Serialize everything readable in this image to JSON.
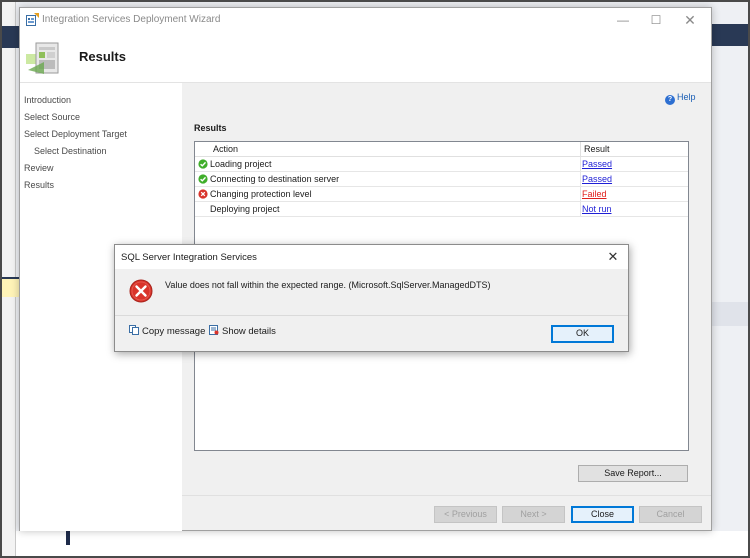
{
  "wizard": {
    "title": "Integration Services Deployment Wizard",
    "page_title": "Results",
    "window_controls": {
      "minimize": "—",
      "maximize": "☐",
      "close": "✕"
    },
    "nav_items": [
      {
        "label": "Introduction"
      },
      {
        "label": "Select Source"
      },
      {
        "label": "Select Deployment Target"
      },
      {
        "label": "Select Destination"
      },
      {
        "label": "Review"
      },
      {
        "label": "Results"
      }
    ],
    "help_label": "Help",
    "results_label": "Results",
    "table": {
      "headers": {
        "action": "Action",
        "result": "Result"
      },
      "rows": [
        {
          "action": "Loading project",
          "result": "Passed",
          "status": "pass"
        },
        {
          "action": "Connecting to destination server",
          "result": "Passed",
          "status": "pass"
        },
        {
          "action": "Changing protection level",
          "result": "Failed",
          "status": "fail"
        },
        {
          "action": "Deploying project",
          "result": "Not run",
          "status": "none"
        }
      ]
    },
    "buttons": {
      "save_report": "Save Report...",
      "previous": "< Previous",
      "next": "Next >",
      "close": "Close",
      "cancel": "Cancel"
    }
  },
  "dialog": {
    "title": "SQL Server Integration Services",
    "close": "✕",
    "message": "Value does not fall within the expected range. (Microsoft.SqlServer.ManagedDTS)",
    "copy_message": "Copy message",
    "show_details": "Show details",
    "ok": "OK"
  },
  "colors": {
    "pass": "#1f1fd6",
    "fail": "#e0201c",
    "pass_icon": "#3fae2a",
    "fail_icon": "#d9342b",
    "accent": "#0078d7"
  }
}
